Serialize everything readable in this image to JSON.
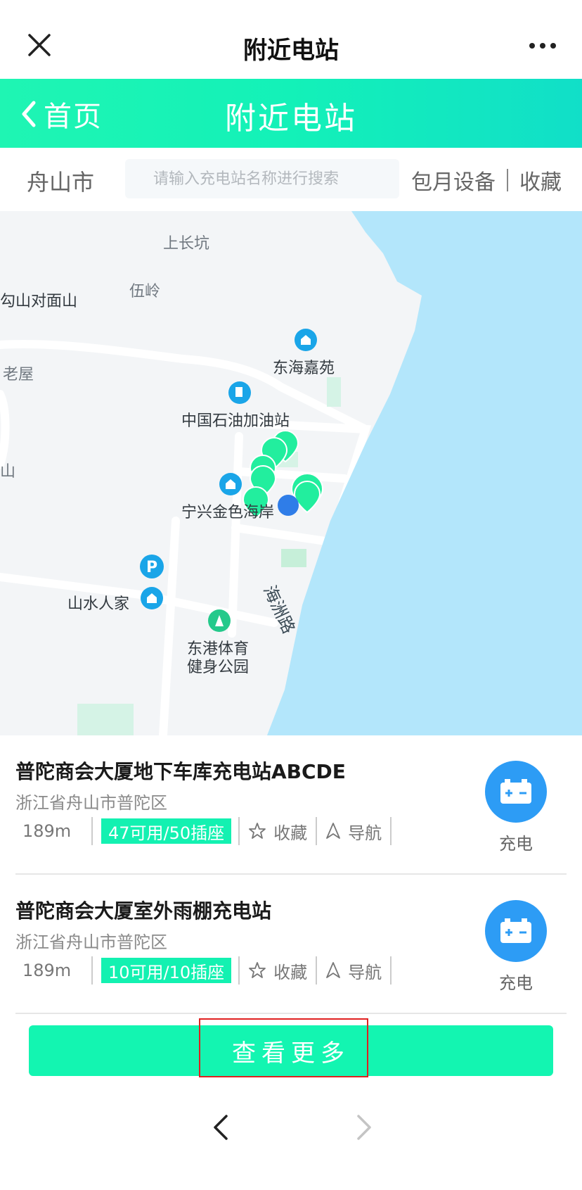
{
  "window": {
    "title": "附近电站",
    "icons": {
      "close": "close-icon",
      "more": "more-horizontal-icon"
    }
  },
  "header": {
    "back_label": "首页",
    "title": "附近电站",
    "colors": {
      "gradient_start": "#1ff5b3",
      "gradient_end": "#11dfc8"
    }
  },
  "search": {
    "city": "舟山市",
    "placeholder": "请输入充电站名称进行搜索",
    "monthly_link": "包月设备",
    "favorites_link": "收藏"
  },
  "map": {
    "labels": {
      "shang_chang_keng": "上长坑",
      "wu_ling": "伍岭",
      "gou_shan": "勾山对面山",
      "lao_wu": "老屋",
      "shan": "山",
      "dong_hai_jia_yuan": "东海嘉苑",
      "sinopec": "中国石油加油站",
      "ning_xing": "宁兴金色海岸",
      "shan_shui": "山水人家",
      "hai_zhou_road": "海洲路",
      "sports_park_line1": "东港体育",
      "sports_park_line2": "健身公园"
    },
    "colors": {
      "water": "#b3e6fb",
      "land": "#f3f5f7",
      "road": "#ffffff",
      "marker": "#22ee9e",
      "poi": "#1aa5e8"
    }
  },
  "stations": [
    {
      "name": "普陀商会大厦地下车库充电站ABCDE",
      "address": "浙江省舟山市普陀区",
      "distance": "189m",
      "availability": "47可用/50插座",
      "favorite_label": "收藏",
      "navigate_label": "导航",
      "charge_label": "充电"
    },
    {
      "name": "普陀商会大厦室外雨棚充电站",
      "address": "浙江省舟山市普陀区",
      "distance": "189m",
      "availability": "10可用/10插座",
      "favorite_label": "收藏",
      "navigate_label": "导航",
      "charge_label": "充电"
    }
  ],
  "see_more": {
    "label": "查看更多",
    "color": "#13f5b1",
    "highlight_color": "#e02020"
  },
  "page_nav": {
    "icons": {
      "back": "chevron-left-icon",
      "forward": "chevron-right-icon"
    }
  }
}
